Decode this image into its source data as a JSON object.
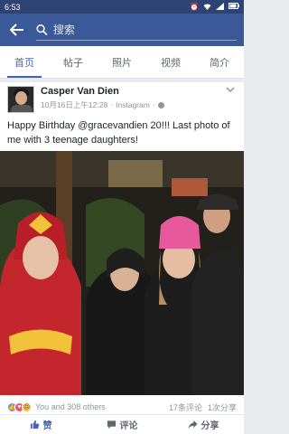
{
  "status_bar": {
    "time": "6:53"
  },
  "app_bar": {
    "search_placeholder": "搜索"
  },
  "tabs": [
    {
      "label": "首页",
      "active": true
    },
    {
      "label": "帖子",
      "active": false
    },
    {
      "label": "照片",
      "active": false
    },
    {
      "label": "视频",
      "active": false
    },
    {
      "label": "简介",
      "active": false
    }
  ],
  "post": {
    "author": "Casper Van Dien",
    "time": "10月16日上午12:28",
    "separator": "·",
    "source": "Instagram",
    "text": "Happy Birthday @gracevandien 20!!! Last photo of me with 3 teenage daughters!",
    "reactions_text": "You and 308 others",
    "comments": "17条评论",
    "shares": "1次分享"
  },
  "actions": {
    "like": "赞",
    "comment": "评论",
    "share": "分享"
  },
  "colors": {
    "brand": "#3b5998",
    "accent": "#4267b2"
  }
}
